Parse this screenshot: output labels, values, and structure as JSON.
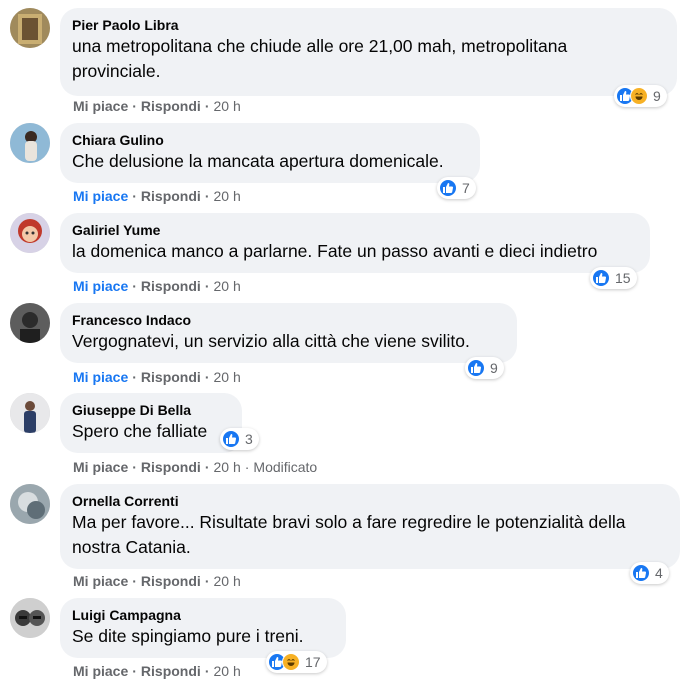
{
  "colors": {
    "brand_blue": "#1877f2",
    "bubble": "#f0f2f5",
    "meta": "#65676b",
    "haha": "#f7b125"
  },
  "icons": {
    "like": "like-reaction-icon",
    "haha": "haha-reaction-icon"
  },
  "comments": [
    {
      "author": "Pier Paolo Libra",
      "text_lines": [
        "una metropolitana che chiude alle ore 21,00 mah, metropolitana",
        "provinciale."
      ],
      "like_label": "Mi piace",
      "reply_label": "Rispondi",
      "time": "20 h",
      "reactions": [
        "like",
        "haha"
      ],
      "count": "9"
    },
    {
      "author": "Chiara Gulino",
      "text_lines": [
        "Che delusione la mancata apertura domenicale."
      ],
      "like_label": "Mi piace",
      "reply_label": "Rispondi",
      "time": "20 h",
      "reactions": [
        "like"
      ],
      "count": "7"
    },
    {
      "author": "Galiriel Yume",
      "text_lines": [
        "la domenica manco a parlarne. Fate un passo avanti e dieci indietro"
      ],
      "like_label": "Mi piace",
      "reply_label": "Rispondi",
      "time": "20 h",
      "reactions": [
        "like"
      ],
      "count": "15"
    },
    {
      "author": "Francesco Indaco",
      "text_lines": [
        "Vergognatevi, un servizio alla città che viene svilito."
      ],
      "like_label": "Mi piace",
      "reply_label": "Rispondi",
      "time": "20 h",
      "reactions": [
        "like"
      ],
      "count": "9"
    },
    {
      "author": "Giuseppe Di Bella",
      "text_lines": [
        "Spero che falliate"
      ],
      "like_label": "Mi piace",
      "reply_label": "Rispondi",
      "time": "20 h",
      "edited": "Modificato",
      "reactions": [
        "like"
      ],
      "count": "3"
    },
    {
      "author": "Ornella Correnti",
      "text_lines": [
        "Ma per favore... Risultate bravi solo a fare regredire le potenzialità della",
        "nostra Catania."
      ],
      "like_label": "Mi piace",
      "reply_label": "Rispondi",
      "time": "20 h",
      "reactions": [
        "like"
      ],
      "count": "4"
    },
    {
      "author": "Luigi Campagna",
      "text_lines": [
        "Se dite spingiamo pure i treni."
      ],
      "like_label": "Mi piace",
      "reply_label": "Rispondi",
      "time": "20 h",
      "reactions": [
        "like",
        "haha"
      ],
      "count": "17"
    }
  ]
}
